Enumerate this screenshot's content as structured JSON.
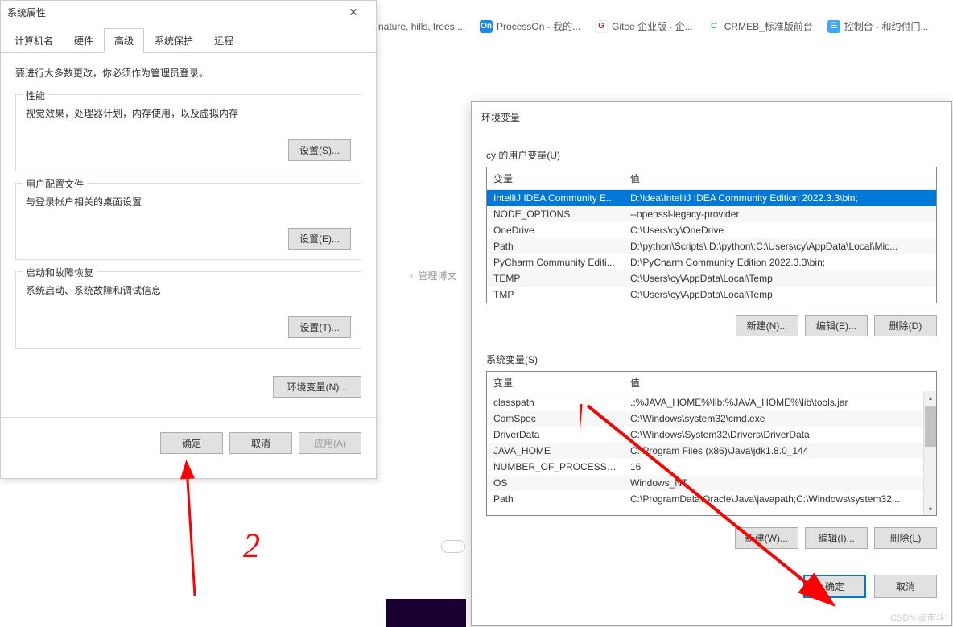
{
  "sysprops": {
    "title": "系统属性",
    "tabs": [
      "计算机名",
      "硬件",
      "高级",
      "系统保护",
      "远程"
    ],
    "active_tab": 2,
    "admin_note": "要进行大多数更改，你必须作为管理员登录。",
    "perf": {
      "title": "性能",
      "desc": "视觉效果，处理器计划，内存使用，以及虚拟内存",
      "btn": "设置(S)..."
    },
    "profiles": {
      "title": "用户配置文件",
      "desc": "与登录帐户相关的桌面设置",
      "btn": "设置(E)..."
    },
    "startup": {
      "title": "启动和故障恢复",
      "desc": "系统启动、系统故障和调试信息",
      "btn": "设置(T)..."
    },
    "env_btn": "环境变量(N)...",
    "ok": "确定",
    "cancel": "取消",
    "apply": "应用(A)"
  },
  "bookmarks": [
    {
      "icon": "",
      "text": "nature, hills, trees,..."
    },
    {
      "icon": "On",
      "cls": "bm-blue",
      "text": "ProcessOn - 我的..."
    },
    {
      "icon": "G",
      "cls": "bm-red",
      "text": "Gitee 企业版 - 企..."
    },
    {
      "icon": "C",
      "cls": "bm-c",
      "text": "CRMEB_标准版前台"
    },
    {
      "icon": "☰",
      "cls": "bm-ctrl",
      "text": "控制台 - 和约付门..."
    }
  ],
  "breadcrumb": {
    "chev": "‹",
    "text": "管理博文"
  },
  "envvars": {
    "title": "环境变量",
    "user_section": "cy 的用户变量(U)",
    "sys_section": "系统变量(S)",
    "col_var": "变量",
    "col_val": "值",
    "user_rows": [
      {
        "name": "IntelliJ IDEA Community E...",
        "value": "D:\\idea\\IntelliJ IDEA Community Edition 2022.3.3\\bin;",
        "selected": true
      },
      {
        "name": "NODE_OPTIONS",
        "value": "--openssl-legacy-provider"
      },
      {
        "name": "OneDrive",
        "value": "C:\\Users\\cy\\OneDrive"
      },
      {
        "name": "Path",
        "value": "D:\\python\\Scripts\\;D:\\python\\;C:\\Users\\cy\\AppData\\Local\\Mic..."
      },
      {
        "name": "PyCharm Community Editi...",
        "value": "D:\\PyCharm Community Edition 2022.3.3\\bin;"
      },
      {
        "name": "TEMP",
        "value": "C:\\Users\\cy\\AppData\\Local\\Temp"
      },
      {
        "name": "TMP",
        "value": "C:\\Users\\cy\\AppData\\Local\\Temp"
      }
    ],
    "sys_rows": [
      {
        "name": "classpath",
        "value": ".;%JAVA_HOME%\\lib;%JAVA_HOME%\\lib\\tools.jar"
      },
      {
        "name": "ComSpec",
        "value": "C:\\Windows\\system32\\cmd.exe"
      },
      {
        "name": "DriverData",
        "value": "C:\\Windows\\System32\\Drivers\\DriverData"
      },
      {
        "name": "JAVA_HOME",
        "value": "C:\\Program Files (x86)\\Java\\jdk1.8.0_144"
      },
      {
        "name": "NUMBER_OF_PROCESSORS",
        "value": "16"
      },
      {
        "name": "OS",
        "value": "Windows_NT"
      },
      {
        "name": "Path",
        "value": "C:\\ProgramData\\Oracle\\Java\\javapath;C:\\Windows\\system32;..."
      }
    ],
    "new_n": "新建(N)...",
    "edit_e": "编辑(E)...",
    "del_d": "删除(D)",
    "new_w": "新建(W)...",
    "edit_i": "编辑(I)...",
    "del_l": "删除(L)",
    "ok": "确定",
    "cancel": "取消"
  },
  "watermark": "CSDN @南斗°"
}
